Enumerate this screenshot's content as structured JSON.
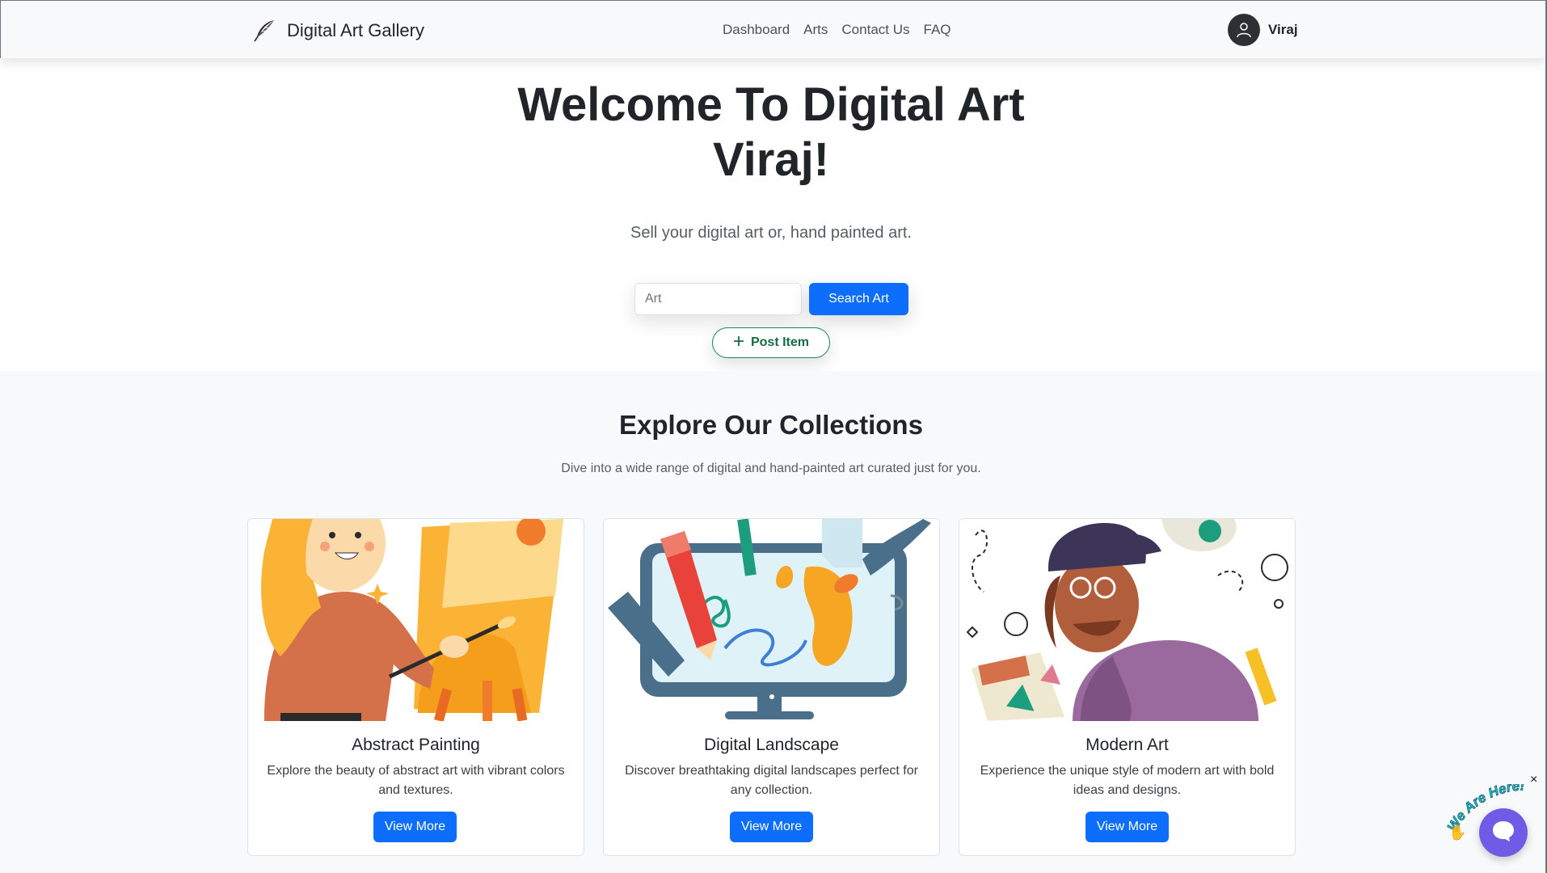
{
  "navbar": {
    "brand": "Digital Art Gallery",
    "brand_icon": "feather-icon",
    "links": [
      "Dashboard",
      "Arts",
      "Contact Us",
      "FAQ"
    ],
    "user_name": "Viraj",
    "avatar_icon": "user-icon"
  },
  "hero": {
    "title_line1": "Welcome To Digital Art",
    "title_line2": "Viraj!",
    "subtitle": "Sell your digital art or, hand painted art.",
    "search_value": "Art",
    "search_button": "Search Art",
    "post_button": "Post Item"
  },
  "collections": {
    "title": "Explore Our Collections",
    "subtitle": "Dive into a wide range of digital and hand-painted art curated just for you.",
    "cards": [
      {
        "title": "Abstract Painting",
        "text": "Explore the beauty of abstract art with vibrant colors and textures.",
        "button": "View More"
      },
      {
        "title": "Digital Landscape",
        "text": "Discover breathtaking digital landscapes perfect for any collection.",
        "button": "View More"
      },
      {
        "title": "Modern Art",
        "text": "Experience the unique style of modern art with bold ideas and designs.",
        "button": "View More"
      }
    ]
  },
  "chat": {
    "label": "We Are Here!",
    "close": "×"
  },
  "colors": {
    "primary": "#0d6efd",
    "success": "#198754",
    "chat": "#6f5ce6"
  }
}
